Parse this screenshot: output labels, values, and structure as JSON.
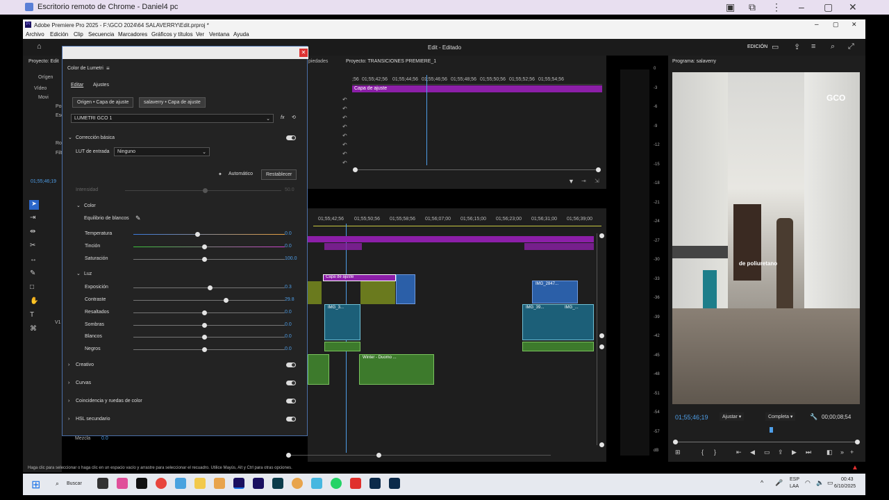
{
  "crd": {
    "title": "Escritorio remoto de Chrome - Daniel4 pc"
  },
  "premiere": {
    "title": "Adobe Premiere Pro 2025 - F:\\GCO 2024\\64 SALAVERRY\\Edit.prproj *",
    "menu": [
      "Archivo",
      "Edición",
      "Clip",
      "Secuencia",
      "Marcadores",
      "Gráficos y títulos",
      "Ver",
      "Ventana",
      "Ayuda"
    ],
    "workspace_title": "Edit - Editado",
    "workspace_mode": "EDICIÓN"
  },
  "project": {
    "tab": "Proyecto: Edit",
    "origin_tab": "Orígen",
    "video_label": "Vídeo",
    "items": [
      "Movi",
      "Pos",
      "Esc",
      "Ro",
      "Filt",
      "Rot"
    ],
    "timecode": "01;55;46;19"
  },
  "source_panel": {
    "tab_props": "piedades",
    "project_tab": "Proyecto: TRANSICIONES PREMIERE_1",
    "ruler": [
      ";56",
      "01;55;42;56",
      "01;55;44;56",
      "01;55;46;56",
      "01;55;48;56",
      "01;55;50;56",
      "01;55;52;56",
      "01;55;54;56"
    ],
    "adj_layer": "Capa de ajuste"
  },
  "timeline": {
    "ruler": [
      "01;55;42;56",
      "01;55;50;56",
      "01;55;58;56",
      "01;56;07;00",
      "01;56;15;00",
      "01;56;23;00",
      "01;56;31;00",
      "01;56;39;00"
    ],
    "clips": {
      "adj": "Capa de ajuste",
      "img_a": "IMG_2847...",
      "img_b": "IMG_3...",
      "img_c": "IMG_39...",
      "img_d": "IMG_...",
      "audio": "Winter - Duomo ...",
      "fx": "fx"
    },
    "track_v1": "V1",
    "mix_label": "Mezcla",
    "mix_value": "0.0"
  },
  "lumetri": {
    "title": "Color de Lumetri",
    "tab_edit": "Editar",
    "tab_settings": "Ajustes",
    "clip_origin": "Origen • Capa de ajuste",
    "clip_seq": "salaverry • Capa de ajuste",
    "preset": "LUMETRI GCO 1",
    "basic_section": "Corrección básica",
    "lut_label": "LUT de entrada",
    "lut_value": "Ninguno",
    "auto_btn": "Automático",
    "reset_btn": "Restablecer",
    "intensity_label": "Intensidad",
    "intensity_value": "50.0",
    "color_section": "Color",
    "wb_label": "Equilibrio de blancos",
    "light_section": "Luz",
    "sliders": [
      {
        "label": "Temperatura",
        "value": "0.0",
        "pos": 0.45
      },
      {
        "label": "Tinción",
        "value": "0.0",
        "pos": 0.5
      },
      {
        "label": "Saturación",
        "value": "100.0",
        "pos": 0.5
      },
      {
        "label": "Exposición",
        "value": "0.3",
        "pos": 0.54
      },
      {
        "label": "Contraste",
        "value": "29.8",
        "pos": 0.65
      },
      {
        "label": "Resaltados",
        "value": "0.0",
        "pos": 0.5
      },
      {
        "label": "Sombras",
        "value": "0.0",
        "pos": 0.5
      },
      {
        "label": "Blancos",
        "value": "0.0",
        "pos": 0.5
      },
      {
        "label": "Negros",
        "value": "0.0",
        "pos": 0.5
      }
    ],
    "sections": [
      "Creativo",
      "Curvas",
      "Coincidencia y ruedas de color",
      "HSL secundario"
    ]
  },
  "program": {
    "tab": "Programa: salaverry",
    "watermark": "GCO",
    "caption": "de poliuretano",
    "timecode": "01;55;46;19",
    "fit": "Ajustar",
    "quality": "Completa",
    "duration": "00;00;08;54"
  },
  "meter": [
    "0",
    "-3",
    "-6",
    "-9",
    "-12",
    "-15",
    "-18",
    "-21",
    "-24",
    "-27",
    "-30",
    "-33",
    "-36",
    "-39",
    "-42",
    "-45",
    "-48",
    "-51",
    "-54",
    "-57",
    "dB"
  ],
  "status_bar": "Haga clic para seleccionar o haga clic en un espacio vacío y arrastre para seleccionar el recuadro. Utilice Mayús, Alt y Ctrl para otras opciones.",
  "taskbar": {
    "search": "Buscar",
    "lang1": "ESP",
    "lang2": "LAA",
    "time": "00:43",
    "date": "6/10/2025"
  }
}
